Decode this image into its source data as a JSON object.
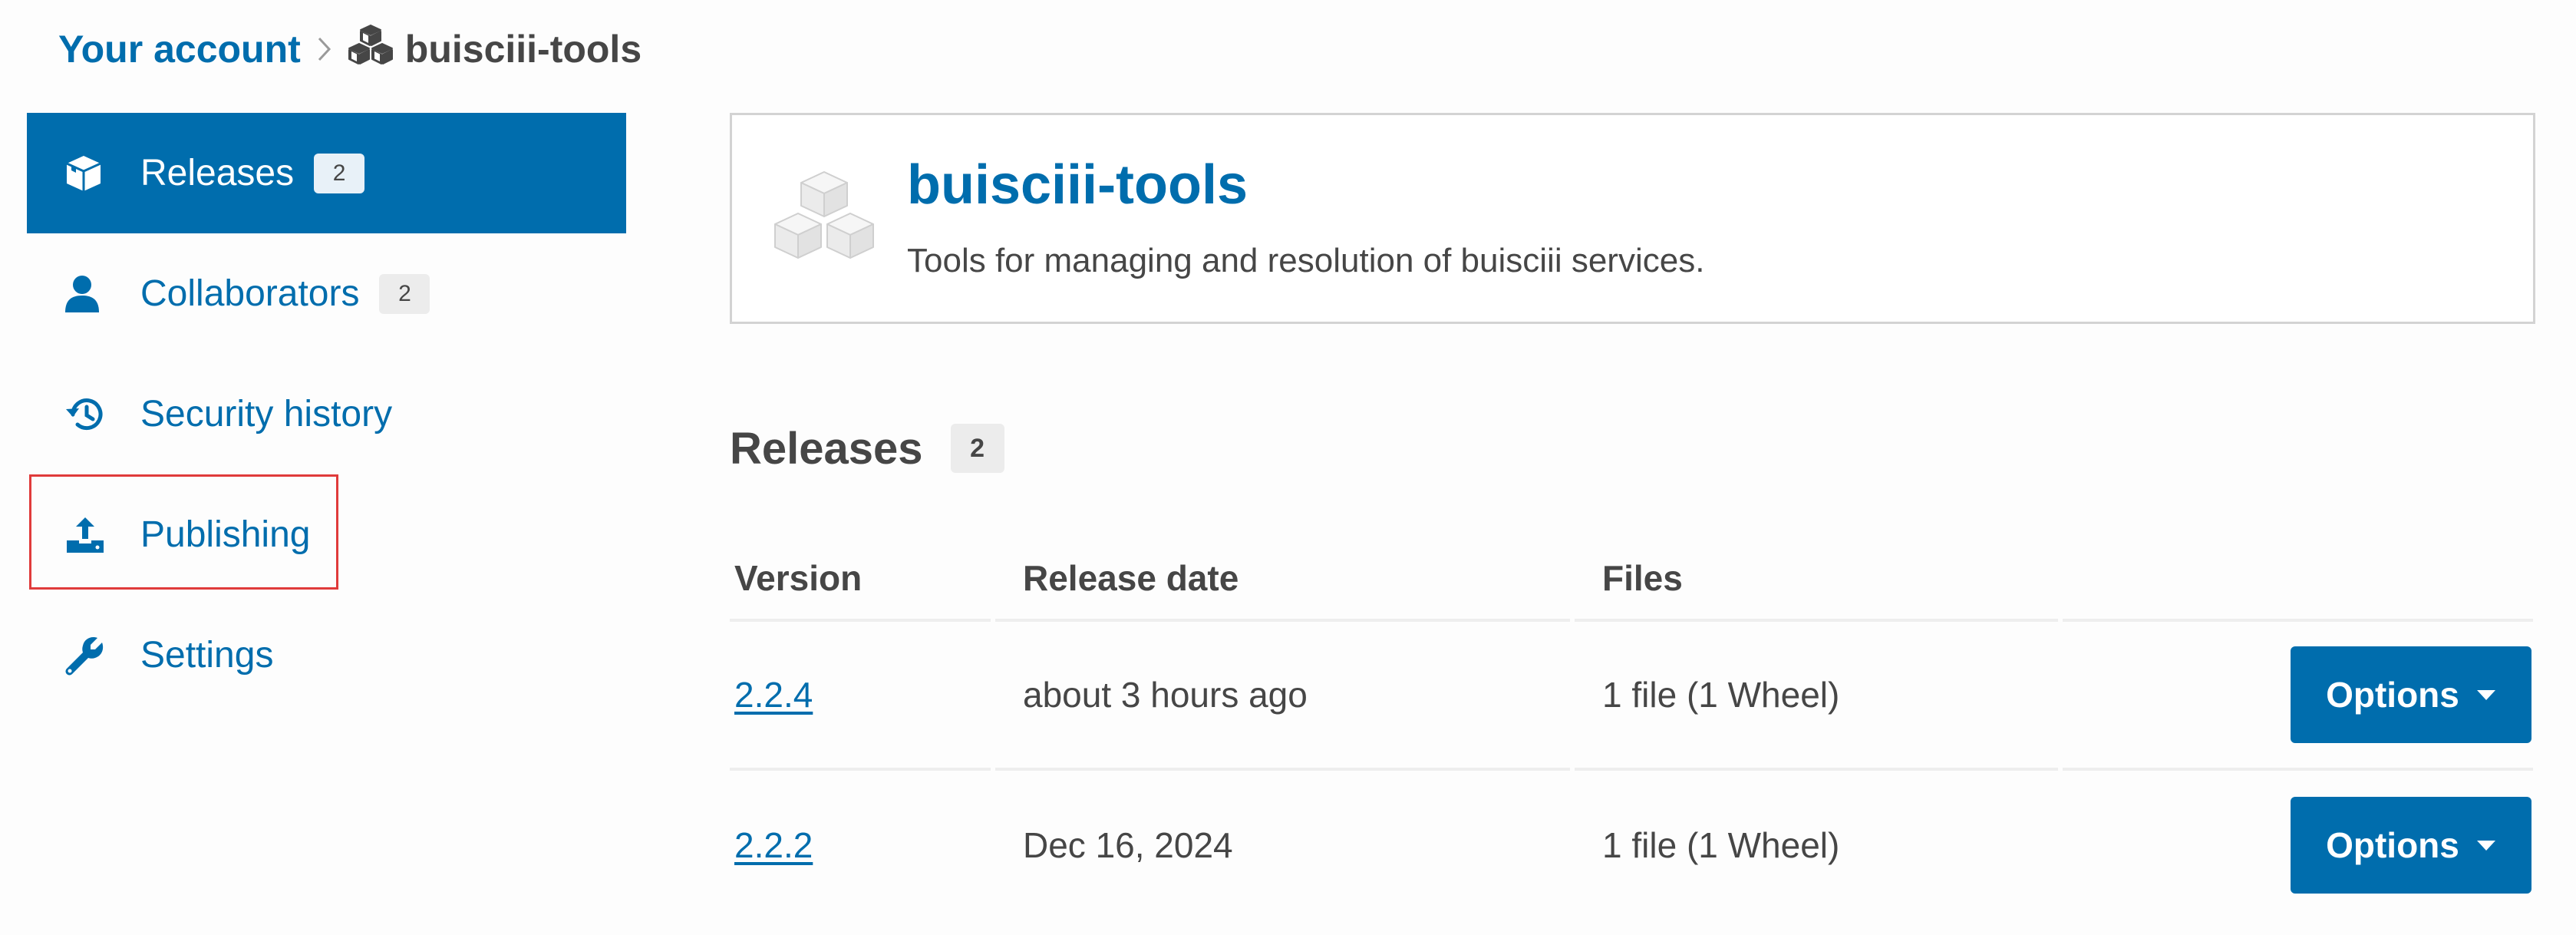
{
  "breadcrumb": {
    "account_label": "Your account",
    "separator_icon": "chevron-right-icon",
    "project_icon": "cubes-icon",
    "project_label": "buisciii-tools"
  },
  "sidebar": {
    "items": [
      {
        "label": "Releases",
        "icon": "box-icon",
        "badge": "2",
        "active": true
      },
      {
        "label": "Collaborators",
        "icon": "user-icon",
        "badge": "2",
        "active": false
      },
      {
        "label": "Security history",
        "icon": "history-icon",
        "active": false
      },
      {
        "label": "Publishing",
        "icon": "upload-icon",
        "active": false,
        "highlighted": true
      },
      {
        "label": "Settings",
        "icon": "wrench-icon",
        "active": false
      }
    ]
  },
  "project": {
    "title": "buisciii-tools",
    "description": "Tools for managing and resolution of buisciii services.",
    "logo_icon": "cubes-icon"
  },
  "releases": {
    "heading": "Releases",
    "count": "2",
    "columns": [
      "Version",
      "Release date",
      "Files"
    ],
    "rows": [
      {
        "version": "2.2.4",
        "date": "about 3 hours ago",
        "files": "1 file (1 Wheel)",
        "button": "Options"
      },
      {
        "version": "2.2.2",
        "date": "Dec 16, 2024",
        "files": "1 file (1 Wheel)",
        "button": "Options"
      }
    ]
  },
  "colors": {
    "accent": "#006dad",
    "highlight_border": "#e03b3b",
    "badge_bg": "#ececec",
    "text": "#464646"
  }
}
